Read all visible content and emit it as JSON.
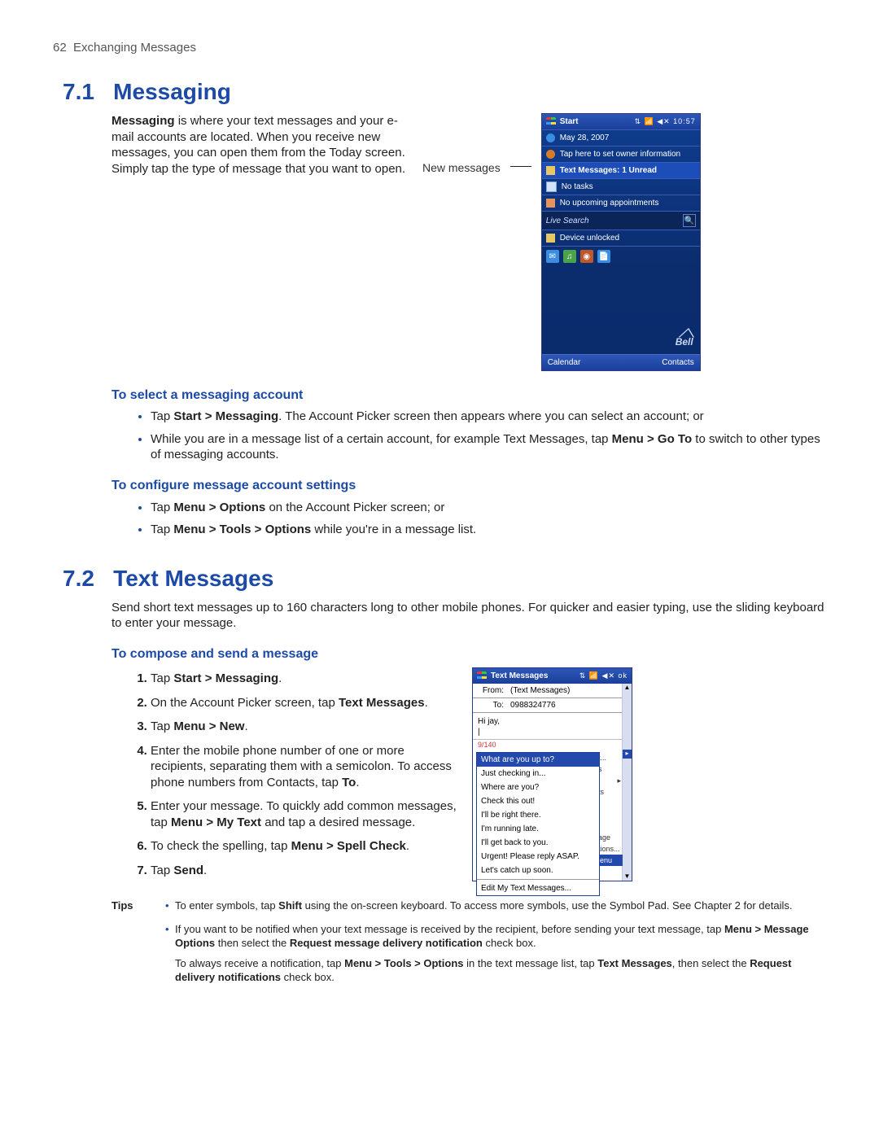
{
  "page_header": {
    "number": "62",
    "chapter": "Exchanging Messages"
  },
  "s71": {
    "num": "7.1",
    "title": "Messaging",
    "intro_pre": "Messaging",
    "intro_post": " is where your text messages and your e-mail accounts are located. When you receive new messages, you can open them from the Today screen. Simply tap the type of message that you want to open.",
    "callout": "New messages",
    "ss1": {
      "start": "Start",
      "status": "⇅  📶 ◀✕ 10:57",
      "date": "May 28, 2007",
      "owner": "Tap here to set owner information",
      "msg": "Text Messages: 1 Unread",
      "tasks": "No tasks",
      "appts": "No upcoming appointments",
      "search": "Live Search",
      "searchIcon": "🔍",
      "unlocked": "Device unlocked",
      "logo": "Bell",
      "calendar": "Calendar",
      "contacts": "Contacts"
    },
    "sub1": {
      "title": "To select a messaging account",
      "b1_a": "Tap ",
      "b1_b": "Start > Messaging",
      "b1_c": ". The Account Picker screen then appears where you can select an account; or",
      "b2_a": "While you are in a message list of a certain account, for example Text Messages, tap ",
      "b2_b": "Menu > Go To",
      "b2_c": " to switch to other types of messaging accounts."
    },
    "sub2": {
      "title": "To configure message account settings",
      "b1_a": "Tap ",
      "b1_b": "Menu > Options",
      "b1_c": " on the Account Picker screen; or",
      "b2_a": "Tap ",
      "b2_b": "Menu > Tools > Options",
      "b2_c": " while you're in a message list."
    }
  },
  "s72": {
    "num": "7.2",
    "title": "Text Messages",
    "intro": "Send short text messages up to 160 characters long to other mobile phones. For quicker and easier typing, use the sliding keyboard to enter your message.",
    "sub1": {
      "title": "To compose and send a message",
      "s1_a": "Tap ",
      "s1_b": "Start > Messaging",
      "s1_c": ".",
      "s2_a": "On the Account Picker screen, tap ",
      "s2_b": "Text Messages",
      "s2_c": ".",
      "s3_a": "Tap ",
      "s3_b": "Menu > New",
      "s3_c": ".",
      "s4_a": "Enter the mobile phone number of one or more recipients, separating them with a semicolon. To access phone numbers from Contacts, tap ",
      "s4_b": "To",
      "s4_c": ".",
      "s5_a": "Enter your message. To quickly add common messages, tap ",
      "s5_b": "Menu > My Text",
      "s5_c": " and tap a desired message.",
      "s6_a": "To check the spelling, tap ",
      "s6_b": "Menu > Spell Check",
      "s6_c": ".",
      "s7_a": "Tap ",
      "s7_b": "Send",
      "s7_c": "."
    },
    "ss2": {
      "title": "Text Messages",
      "status": "⇅  📶 ◀✕  ok",
      "from_lbl": "From:",
      "from_val": "(Text Messages)",
      "to_lbl": "To:",
      "to_val": "0988324776",
      "greeting": "Hi jay,",
      "count": "9/140",
      "menu": [
        "What are you up to?",
        "Just checking in...",
        "Where are you?",
        "Check this out!",
        "I'll be right there.",
        "I'm running late.",
        "I'll get back to you.",
        "Urgent! Please reply ASAP.",
        "Let's catch up soon."
      ],
      "edit": "Edit My Text Messages...",
      "side": [
        "t...",
        "s",
        "▸",
        "ts",
        "",
        "age",
        "tions...",
        "lenu"
      ]
    },
    "tips": {
      "label": "Tips",
      "t1_a": "To enter symbols, tap ",
      "t1_b": "Shift",
      "t1_c": " using the on-screen keyboard. To access more symbols, use the Symbol Pad. See Chapter 2 for details.",
      "t2_a": "If you want to be notified when your text message is received by the recipient, before sending your text message, tap ",
      "t2_b": "Menu > Message Options",
      "t2_c": " then select the ",
      "t2_d": "Request message delivery notification",
      "t2_e": " check box.",
      "t2_f": "To always receive a notification, tap ",
      "t2_g": "Menu > Tools > Options",
      "t2_h": " in the text message list, tap ",
      "t2_i": "Text Messages",
      "t2_j": ", then select the ",
      "t2_k": "Request delivery notifications",
      "t2_l": " check box."
    }
  }
}
